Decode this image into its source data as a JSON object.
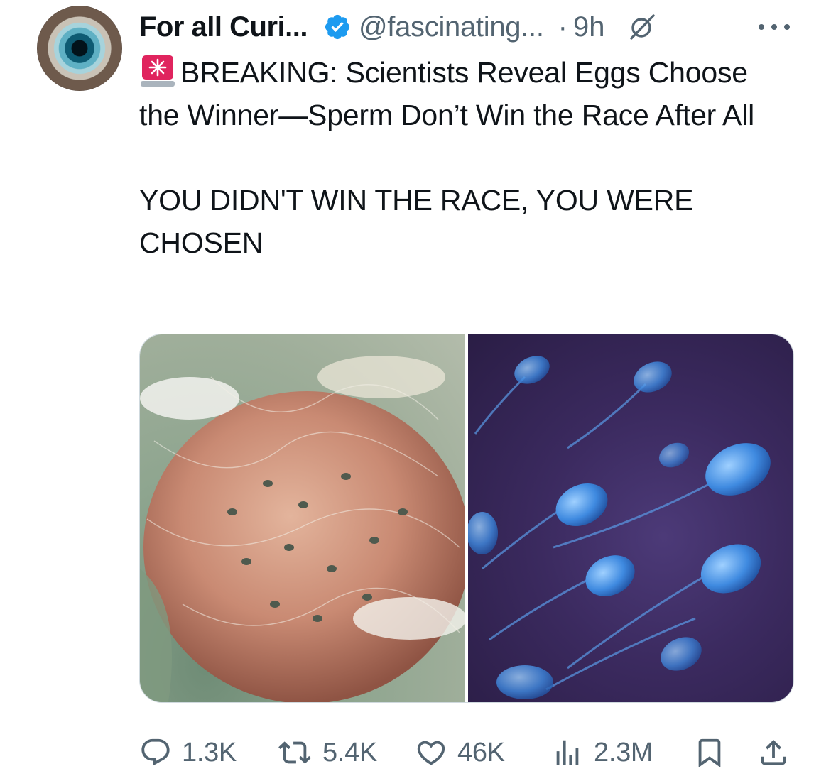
{
  "tweet": {
    "author_name": "For all Curi...",
    "handle": "@fascinating...",
    "separator": "·",
    "time": "9h",
    "text_line1": "BREAKING: Scientists Reveal Eggs Choose the Winner—Sperm Don’t Win the Race After All",
    "text_line2": "YOU DIDN'T WIN THE RACE, YOU WERE CHOSEN",
    "media": [
      {
        "icon": "egg-fertilization-image"
      },
      {
        "icon": "sperm-cells-image"
      }
    ]
  },
  "actions": {
    "replies": "1.3K",
    "reposts": "5.4K",
    "likes": "46K",
    "views": "2.3M"
  },
  "colors": {
    "text": "#0f1419",
    "secondary": "#536471",
    "verified": "#1d9bf0",
    "siren": "#e0245e"
  }
}
